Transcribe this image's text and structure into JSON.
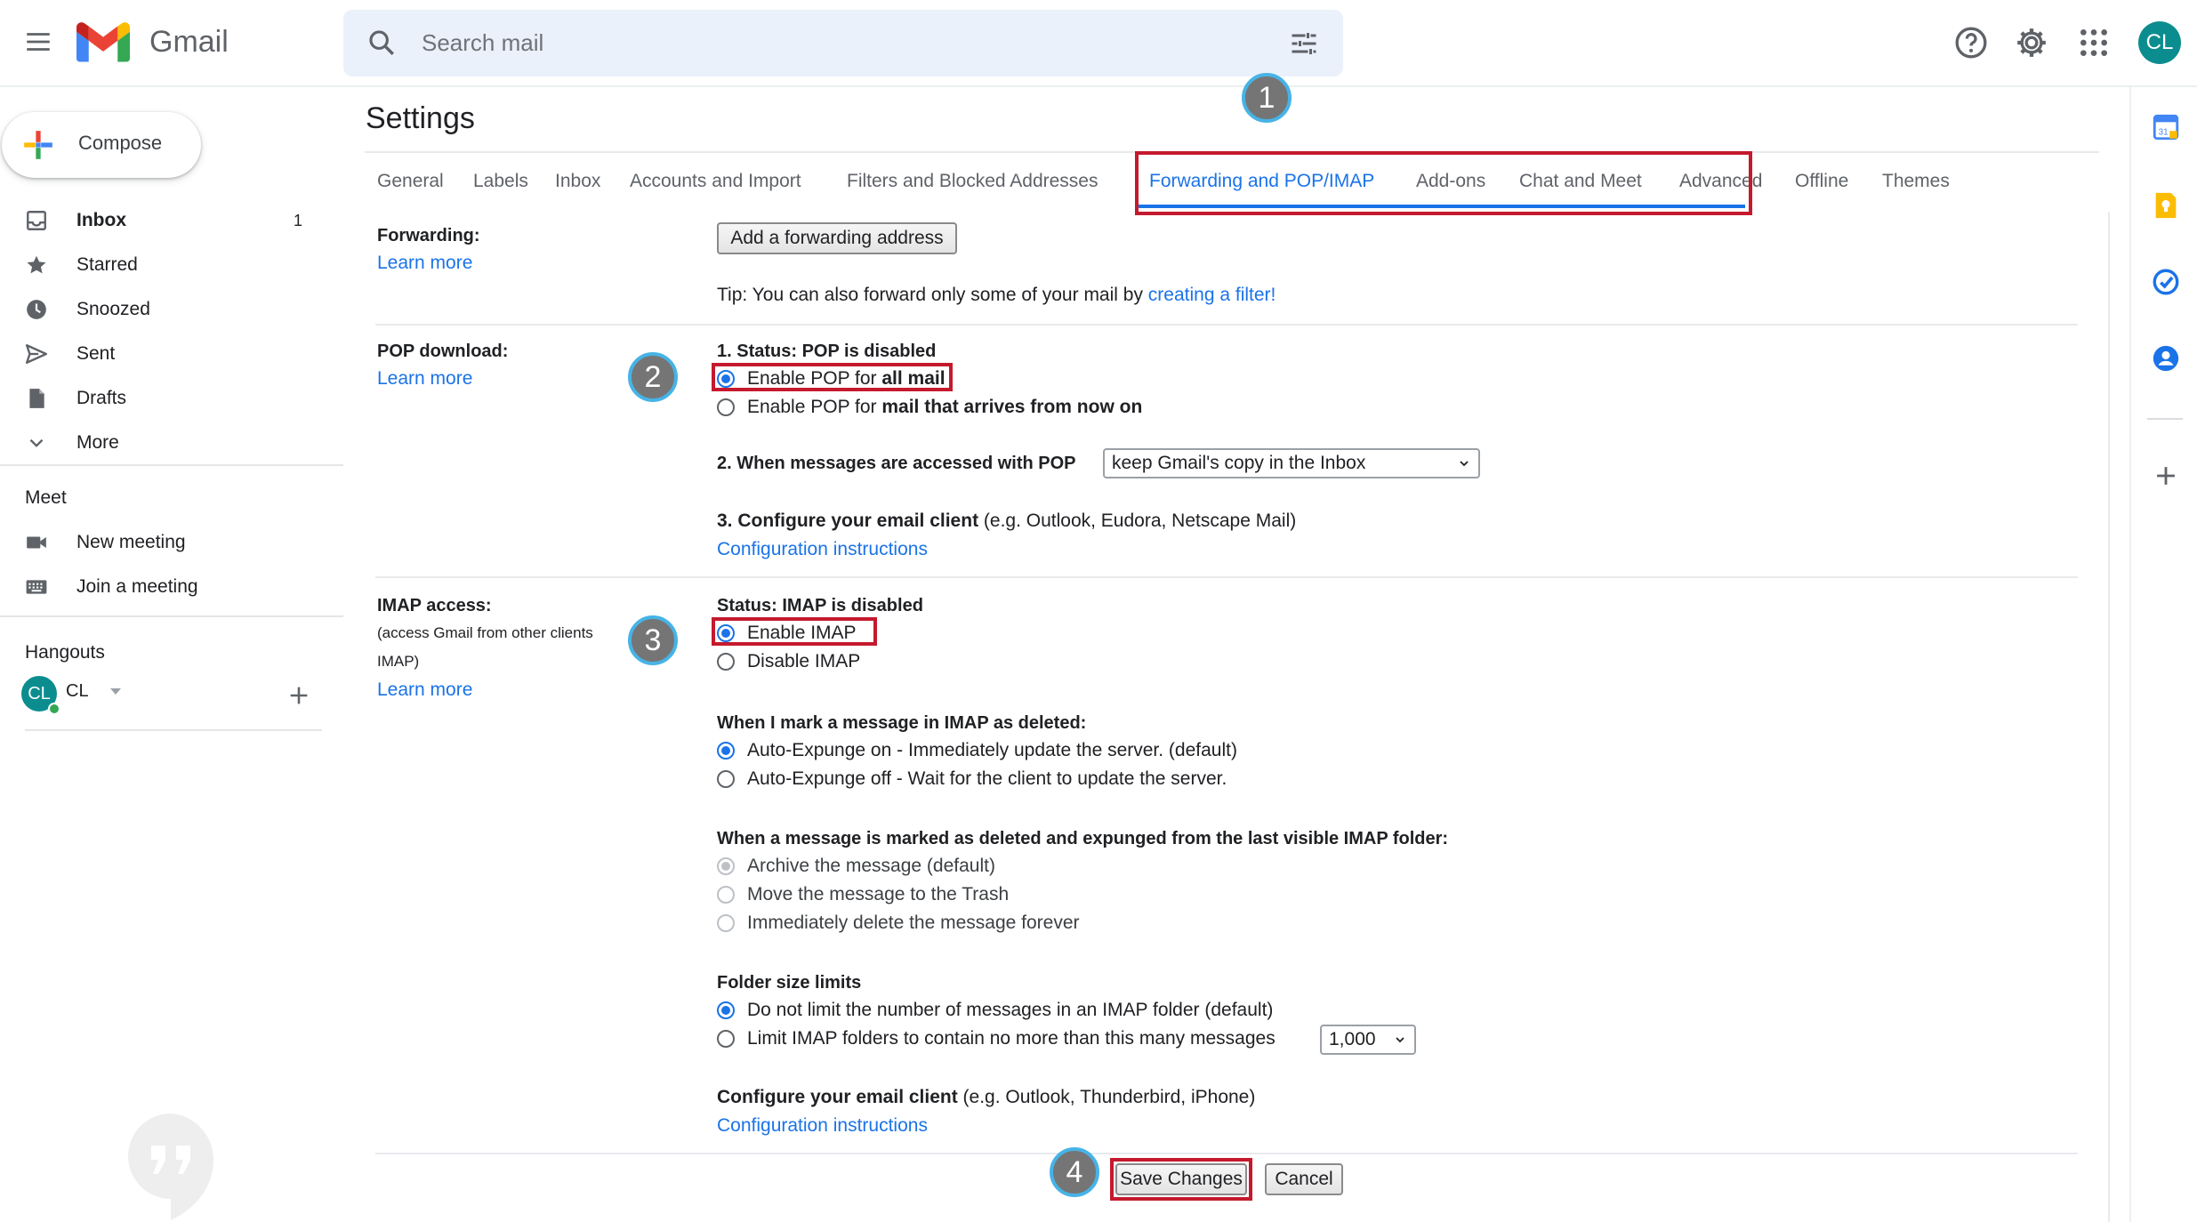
{
  "header": {
    "app_name": "Gmail",
    "search_placeholder": "Search mail",
    "avatar_initials": "CL",
    "icons": [
      "menu-icon",
      "gmail-logo",
      "search-icon",
      "search-options-icon",
      "help-icon",
      "gear-icon",
      "apps-grid-icon"
    ]
  },
  "sidebar": {
    "compose_label": "Compose",
    "items": [
      {
        "label": "Inbox",
        "count": "1",
        "icon": "inbox-icon"
      },
      {
        "label": "Starred",
        "icon": "star-icon"
      },
      {
        "label": "Snoozed",
        "icon": "clock-icon"
      },
      {
        "label": "Sent",
        "icon": "send-icon"
      },
      {
        "label": "Drafts",
        "icon": "draft-icon"
      },
      {
        "label": "More",
        "icon": "chevron-down-icon"
      }
    ],
    "meet": {
      "title": "Meet",
      "items": [
        {
          "label": "New meeting",
          "icon": "video-icon"
        },
        {
          "label": "Join a meeting",
          "icon": "keyboard-icon"
        }
      ]
    },
    "hangouts": {
      "title": "Hangouts",
      "user_initials": "CL",
      "user_name": "CL"
    }
  },
  "settings": {
    "title": "Settings",
    "tabs": [
      "General",
      "Labels",
      "Inbox",
      "Accounts and Import",
      "Filters and Blocked Addresses",
      "Forwarding and POP/IMAP",
      "Add-ons",
      "Chat and Meet",
      "Advanced",
      "Offline",
      "Themes"
    ],
    "active_tab": "Forwarding and POP/IMAP",
    "forwarding": {
      "label": "Forwarding:",
      "learn_more": "Learn more",
      "add_button": "Add a forwarding address",
      "tip_prefix": "Tip: You can also forward only some of your mail by ",
      "tip_link": "creating a filter!"
    },
    "pop": {
      "label": "POP download:",
      "learn_more": "Learn more",
      "status": "1. Status: POP is disabled",
      "opt_all_prefix": "Enable POP for ",
      "opt_all_bold": "all mail",
      "opt_now_prefix": "Enable POP for ",
      "opt_now_bold": "mail that arrives from now on",
      "selected": "all mail",
      "accessed_label": "2. When messages are accessed with POP",
      "accessed_value": "keep Gmail's copy in the Inbox",
      "configure_bold": "3. Configure your email client",
      "configure_rest": " (e.g. Outlook, Eudora, Netscape Mail)",
      "config_link": "Configuration instructions"
    },
    "imap": {
      "label": "IMAP access:",
      "sublabel_line1": "(access Gmail from other clients",
      "sublabel_line2": "IMAP)",
      "learn_more": "Learn more",
      "status": "Status: IMAP is disabled",
      "enable": "Enable IMAP",
      "disable": "Disable IMAP",
      "selected": "Enable IMAP",
      "deleted_title": "When I mark a message in IMAP as deleted:",
      "deleted_opts": [
        "Auto-Expunge on - Immediately update the server. (default)",
        "Auto-Expunge off - Wait for the client to update the server."
      ],
      "deleted_selected": 0,
      "expunged_title": "When a message is marked as deleted and expunged from the last visible IMAP folder:",
      "expunged_opts": [
        "Archive the message (default)",
        "Move the message to the Trash",
        "Immediately delete the message forever"
      ],
      "expunged_selected": 0,
      "folder_title": "Folder size limits",
      "folder_opts": [
        "Do not limit the number of messages in an IMAP folder (default)",
        "Limit IMAP folders to contain no more than this many messages"
      ],
      "folder_selected": 0,
      "folder_limit_value": "1,000",
      "configure_bold": "Configure your email client",
      "configure_rest": " (e.g. Outlook, Thunderbird, iPhone)",
      "config_link": "Configuration instructions"
    },
    "save_button": "Save Changes",
    "cancel_button": "Cancel"
  },
  "annotations": {
    "markers": [
      "1",
      "2",
      "3",
      "4"
    ],
    "highlight_color": "#c5192d",
    "marker_color": "#757575",
    "marker_ring": "#47b3e6"
  },
  "colors": {
    "accent": "#1a73e8",
    "search_bg": "#eaf1fb",
    "avatar_bg": "#0b8d8f"
  }
}
